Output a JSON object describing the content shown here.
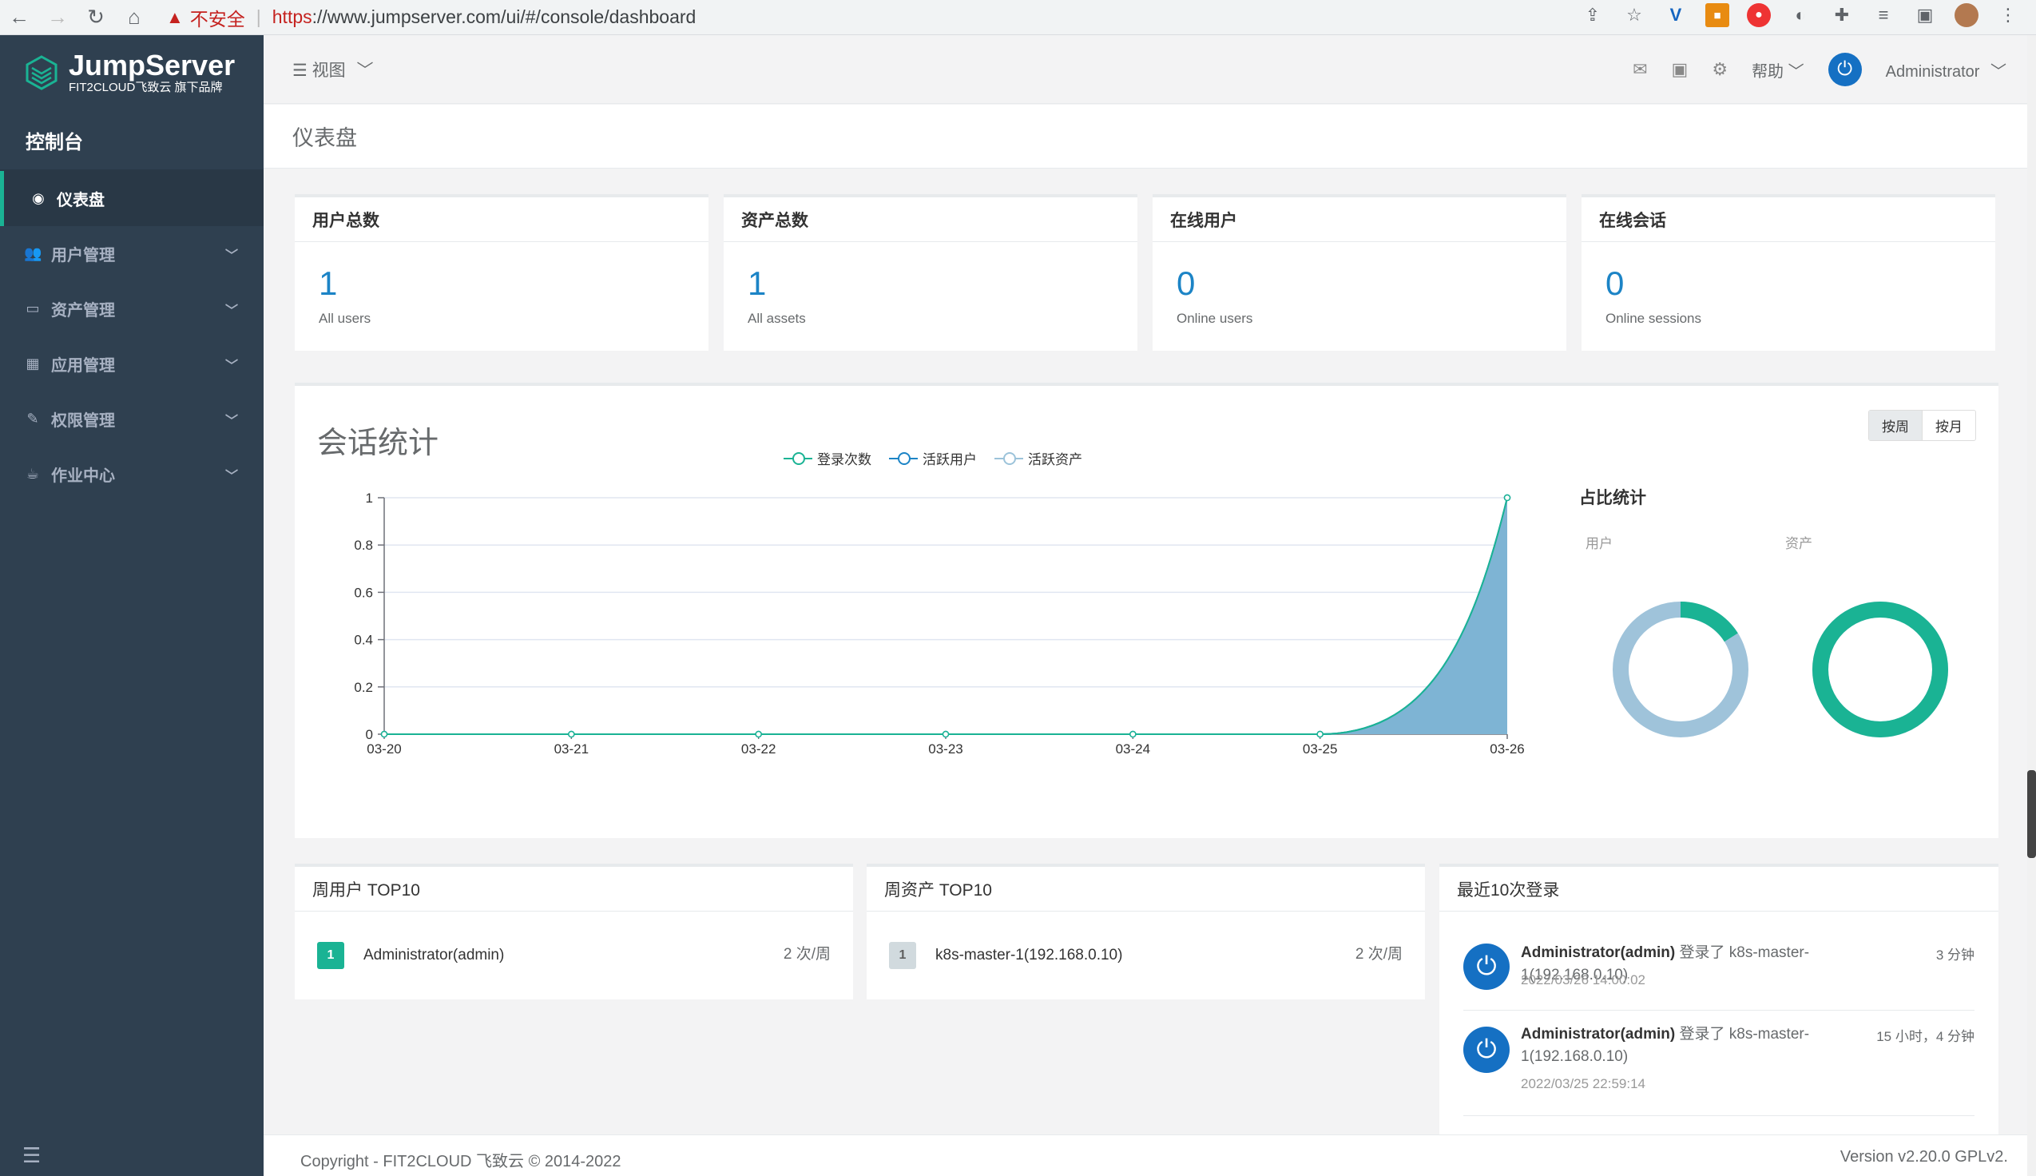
{
  "browser": {
    "insecure_label": "不安全",
    "url_scheme": "https",
    "url_rest": "://www.jumpserver.com/ui/#/console/dashboard"
  },
  "sidebar": {
    "logo_title": "JumpServer",
    "logo_subtitle": "FIT2CLOUD飞致云 旗下品牌",
    "console_title": "控制台",
    "items": [
      {
        "label": "仪表盘",
        "icon": "dashboard-icon",
        "active": true
      },
      {
        "label": "用户管理",
        "icon": "users-icon"
      },
      {
        "label": "资产管理",
        "icon": "inbox-icon"
      },
      {
        "label": "应用管理",
        "icon": "grid-icon"
      },
      {
        "label": "权限管理",
        "icon": "edit-icon"
      },
      {
        "label": "作业中心",
        "icon": "coffee-icon"
      }
    ]
  },
  "topbar": {
    "view_label": "视图",
    "help_label": "帮助",
    "user_label": "Administrator"
  },
  "page": {
    "title": "仪表盘"
  },
  "stats": [
    {
      "title": "用户总数",
      "value": "1",
      "desc": "All users"
    },
    {
      "title": "资产总数",
      "value": "1",
      "desc": "All assets"
    },
    {
      "title": "在线用户",
      "value": "0",
      "desc": "Online users"
    },
    {
      "title": "在线会话",
      "value": "0",
      "desc": "Online sessions"
    }
  ],
  "session_stats": {
    "title": "会话统计",
    "week_label": "按周",
    "month_label": "按月",
    "ratio_title": "占比统计",
    "ratio_user_label": "用户",
    "ratio_asset_label": "资产"
  },
  "colors": {
    "login_count": "#1ab394",
    "active_users": "#1c84c6",
    "active_assets": "#9cc3da",
    "area_fill": "#7eb4d4",
    "donut_green": "#1ab394",
    "donut_light": "#9fc3da"
  },
  "chart_data": {
    "type": "area",
    "x": [
      "03-20",
      "03-21",
      "03-22",
      "03-23",
      "03-24",
      "03-25",
      "03-26"
    ],
    "ylim": [
      0,
      1
    ],
    "yticks": [
      "0",
      "0.2",
      "0.4",
      "0.6",
      "0.8",
      "1"
    ],
    "legend": "top-center",
    "grid": true,
    "series": [
      {
        "name": "登录次数",
        "values": [
          0,
          0,
          0,
          0,
          0,
          0,
          1
        ]
      },
      {
        "name": "活跃用户",
        "values": [
          0,
          0,
          0,
          0,
          0,
          0,
          1
        ]
      },
      {
        "name": "活跃资产",
        "values": [
          0,
          0,
          0,
          0,
          0,
          0,
          1
        ]
      }
    ]
  },
  "ratio_data": [
    {
      "name": "用户",
      "active_fraction": 0.16
    },
    {
      "name": "资产",
      "active_fraction": 1.0
    }
  ],
  "top_users": {
    "title": "周用户 TOP10",
    "rows": [
      {
        "rank": "1",
        "name": "Administrator(admin)",
        "count": "2 次/周"
      }
    ]
  },
  "top_assets": {
    "title": "周资产 TOP10",
    "rows": [
      {
        "rank": "1",
        "name": "k8s-master-1(192.168.0.10)",
        "count": "2 次/周"
      }
    ]
  },
  "recent_logins": {
    "title": "最近10次登录",
    "items": [
      {
        "user": "Administrator(admin)",
        "action": "登录了 k8s-master-1(192.168.0.10)",
        "ago": "3 分钟",
        "time": "2022/03/26 14:00:02"
      },
      {
        "user": "Administrator(admin)",
        "action": "登录了 k8s-master-1(192.168.0.10)",
        "ago": "15 小时，4 分钟",
        "time": "2022/03/25 22:59:14"
      }
    ]
  },
  "footer": {
    "copyright": "Copyright - FIT2CLOUD 飞致云 © 2014-2022",
    "version": "Version v2.20.0 GPLv2."
  }
}
